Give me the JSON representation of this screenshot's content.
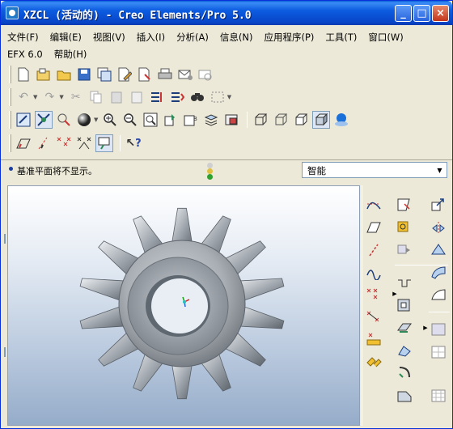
{
  "window": {
    "title": "XZCL (活动的) - Creo Elements/Pro 5.0",
    "controls": {
      "minimize": "_",
      "maximize": "□",
      "close": "×"
    }
  },
  "menu": {
    "items": [
      "文件(F)",
      "编辑(E)",
      "视图(V)",
      "插入(I)",
      "分析(A)",
      "信息(N)",
      "应用程序(P)",
      "工具(T)",
      "窗口(W)"
    ],
    "items2": [
      "EFX 6.0",
      "帮助(H)"
    ]
  },
  "toolbars": {
    "row1": [
      "new-icon",
      "open-icon",
      "folder-icon",
      "save-icon",
      "save-copy-icon",
      "edit-icon",
      "erase-icon",
      "print-icon",
      "mail-icon",
      "mail-link-icon"
    ],
    "row2": [
      "undo-icon",
      "redo-icon",
      "cut-icon",
      "copy-icon",
      "paste-icon",
      "paste-special-icon",
      "regenerate-icon",
      "regenerate-manager-icon",
      "find-icon",
      "select-box-icon"
    ],
    "row3": [
      "repaint-icon",
      "spin-center-icon",
      "orient-icon",
      "appearance-icon",
      "zoom-in-icon",
      "zoom-out-icon",
      "refit-icon",
      "reorient-icon",
      "saved-views-icon",
      "layers-icon",
      "view-manager-icon",
      "wireframe-icon",
      "hidden-line-icon",
      "no-hidden-icon",
      "shading-icon",
      "enhanced-realism-icon"
    ],
    "row4": [
      "datum-planes-icon",
      "datum-axes-icon",
      "datum-points-icon",
      "coordinate-systems-icon",
      "annotation-icon",
      "context-help-icon"
    ],
    "context_help_glyph": "?"
  },
  "status": {
    "message": "基准平面将不显示。",
    "filter_value": "智能"
  },
  "right_toolbar": {
    "icons": [
      "sketch-curve-icon",
      "sketch-icon",
      "copy-geometry-icon",
      "datum-plane-icon",
      "sketch-view-icon",
      "mirror-icon",
      "datum-axis-icon",
      "insert-feature-icon",
      "trim-icon",
      "datum-curve-icon",
      "fillet-icon",
      "datum-point-icon",
      "shell-icon",
      "round-icon",
      "offset-point-icon",
      "hole-icon",
      "extrude-icon",
      "field-point-icon",
      "rib-icon",
      "chamfer-icon",
      "csys-icon",
      "draft-icon",
      "pattern-icon",
      "array-icon"
    ]
  },
  "colors": {
    "title_bar": "#0845c8",
    "gear_face": "#a9aeb4",
    "gear_shadow": "#6e747b",
    "viewport_top": "#ffffff",
    "viewport_bottom": "#95acc9"
  }
}
